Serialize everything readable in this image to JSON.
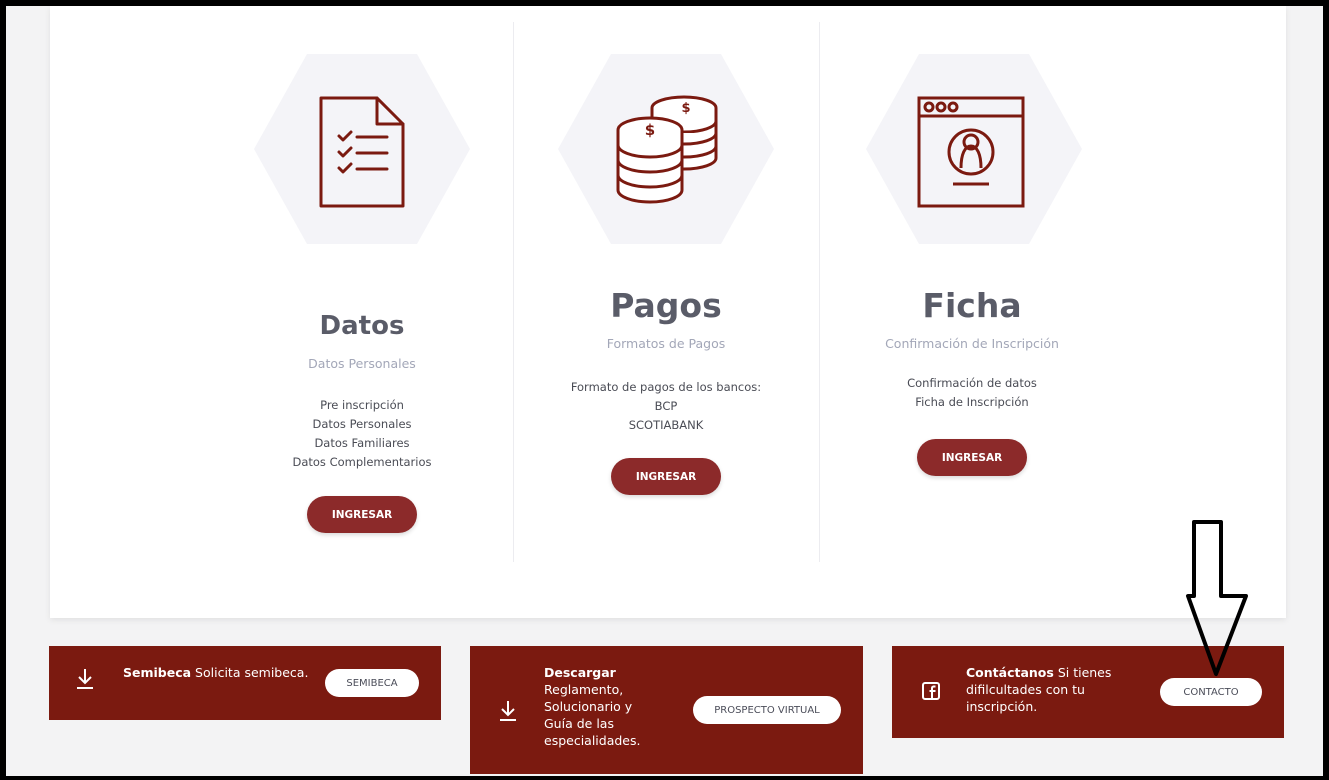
{
  "columns": [
    {
      "title": "Datos",
      "subtitle": "Datos Personales",
      "lines": [
        "Pre inscripción",
        "Datos Personales",
        "Datos Familiares",
        "Datos Complementarios"
      ],
      "button": "INGRESAR",
      "icon": "checklist-document-icon"
    },
    {
      "title": "Pagos",
      "subtitle": "Formatos de Pagos",
      "lines": [
        "Formato de pagos de los bancos:",
        "BCP",
        "SCOTIABANK"
      ],
      "button": "INGRESAR",
      "icon": "coins-stack-icon"
    },
    {
      "title": "Ficha",
      "subtitle": "Confirmación de Inscripción",
      "lines": [
        "Confirmación de datos",
        "Ficha de Inscripción"
      ],
      "button": "INGRESAR",
      "icon": "browser-profile-icon"
    }
  ],
  "panels": {
    "semibeca": {
      "bold": "Semibeca",
      "text": "Solicita semibeca.",
      "button": "SEMIBECA",
      "icon": "download-icon"
    },
    "descargar": {
      "bold": "Descargar",
      "text": "Reglamento, Solucionario y Guía de las especialidades.",
      "button": "PROSPECTO VIRTUAL",
      "icon": "download-icon"
    },
    "contacto": {
      "bold": "Contáctanos",
      "text": "Si tienes difilcultades con tu inscripción.",
      "button": "CONTACTO",
      "icon": "facebook-icon"
    }
  },
  "colors": {
    "brand": "#7b1a10",
    "button": "#8c2a2a",
    "icon_stroke": "#7b1a10",
    "hexagon": "#f4f4f8",
    "title": "#5a5c68",
    "subtitle": "#a3a7b8"
  },
  "annotation": {
    "icon": "down-arrow-outline-icon"
  }
}
